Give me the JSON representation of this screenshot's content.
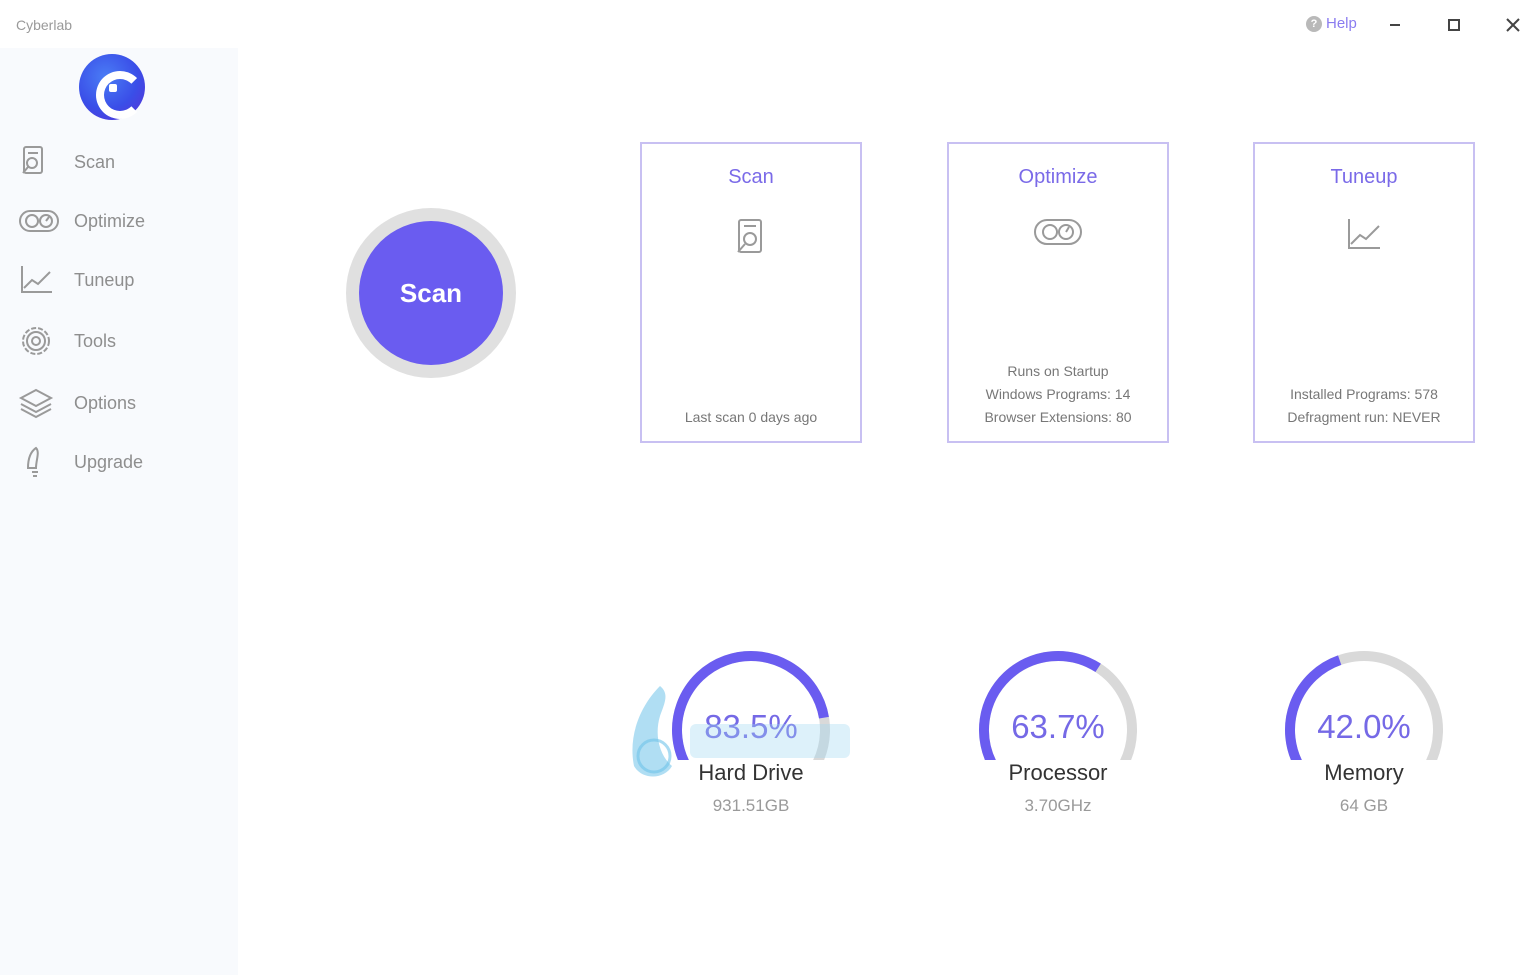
{
  "app": {
    "title": "Cyberlab"
  },
  "titlebar": {
    "help_label": "Help"
  },
  "sidebar": {
    "items": [
      {
        "label": "Scan",
        "icon": "scan-icon"
      },
      {
        "label": "Optimize",
        "icon": "optimize-icon"
      },
      {
        "label": "Tuneup",
        "icon": "tuneup-icon"
      },
      {
        "label": "Tools",
        "icon": "gear-icon"
      },
      {
        "label": "Options",
        "icon": "layers-icon"
      },
      {
        "label": "Upgrade",
        "icon": "rocket-icon"
      }
    ]
  },
  "main": {
    "scan_button_label": "Scan",
    "cards": [
      {
        "title": "Scan",
        "icon": "scan-icon",
        "lines": [
          "Last scan 0 days ago"
        ]
      },
      {
        "title": "Optimize",
        "icon": "optimize-icon",
        "lines": [
          "Runs on Startup",
          "Windows Programs: 14",
          "Browser Extensions: 80"
        ]
      },
      {
        "title": "Tuneup",
        "icon": "tuneup-icon",
        "lines": [
          "Installed Programs: 578",
          "Defragment run: NEVER"
        ]
      }
    ],
    "gauges": [
      {
        "percent_label": "83.5%",
        "value": 0.835,
        "name": "Hard Drive",
        "detail": "931.51GB"
      },
      {
        "percent_label": "63.7%",
        "value": 0.637,
        "name": "Processor",
        "detail": "3.70GHz"
      },
      {
        "percent_label": "42.0%",
        "value": 0.42,
        "name": "Memory",
        "detail": "64 GB"
      }
    ]
  },
  "colors": {
    "accent": "#6a5cf0",
    "gauge_track": "#d9d9d9",
    "card_border": "#c8c0f2"
  }
}
